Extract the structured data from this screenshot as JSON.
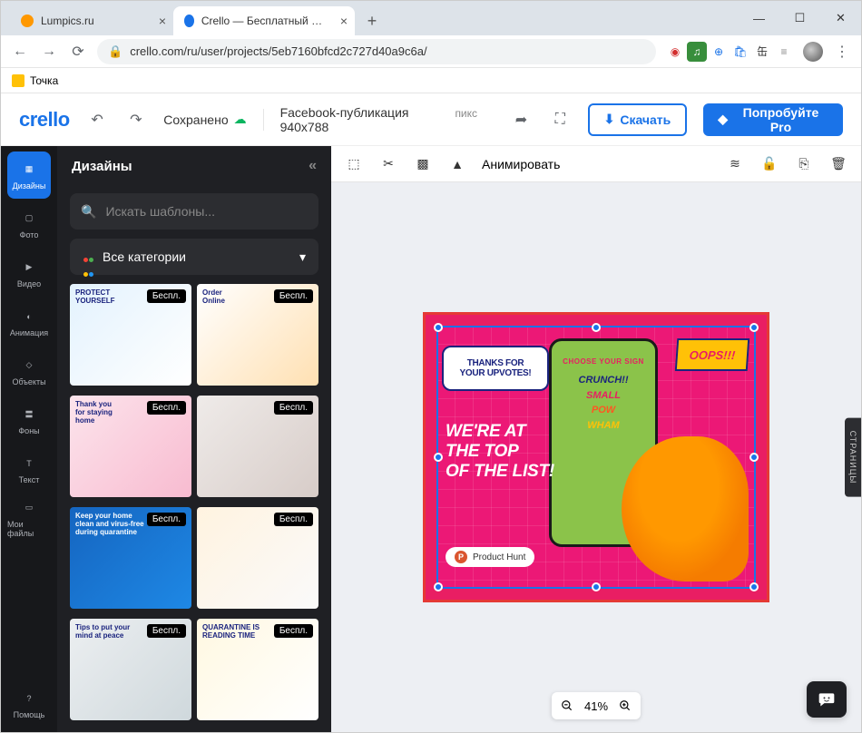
{
  "browser": {
    "tabs": [
      {
        "title": "Lumpics.ru",
        "favicon_color": "#ff9800",
        "active": false
      },
      {
        "title": "Crello — Бесплатный инструмен",
        "favicon_color": "#1a73e8",
        "active": true
      }
    ],
    "url": "crello.com/ru/user/projects/5eb7160bfcd2c727d40a9c6a/",
    "bookmarks": [
      {
        "label": "Точка"
      }
    ]
  },
  "header": {
    "logo": "crello",
    "saved_label": "Сохранено",
    "doc_name": "Facebook-публикация 940x788",
    "dim_suffix": "пикс",
    "download_label": "Скачать",
    "pro_label": "Попробуйте Pro"
  },
  "rail": {
    "items": [
      {
        "id": "designs",
        "label": "Дизайны"
      },
      {
        "id": "photo",
        "label": "Фото"
      },
      {
        "id": "video",
        "label": "Видео"
      },
      {
        "id": "animation",
        "label": "Анимация"
      },
      {
        "id": "objects",
        "label": "Объекты"
      },
      {
        "id": "backgrounds",
        "label": "Фоны"
      },
      {
        "id": "text",
        "label": "Текст"
      },
      {
        "id": "myfiles",
        "label": "Мои файлы"
      }
    ],
    "help_label": "Помощь"
  },
  "panel": {
    "title": "Дизайны",
    "search_placeholder": "Искать шаблоны...",
    "category_label": "Все категории",
    "free_badge": "Беспл.",
    "templates": [
      {
        "style": "tpl1",
        "label": "PROTECT\nYOURSELF"
      },
      {
        "style": "tpl2",
        "label": "Order\nOnline"
      },
      {
        "style": "tpl3",
        "label": "Thank you\nfor staying\nhome"
      },
      {
        "style": "tpl4",
        "label": ""
      },
      {
        "style": "tpl5",
        "label": "Keep your home\nclean and virus-free\nduring quarantine"
      },
      {
        "style": "tpl6",
        "label": ""
      },
      {
        "style": "tpl7",
        "label": "Tips to put your\nmind at peace"
      },
      {
        "style": "tpl8",
        "label": "QUARANTINE IS\nREADING TIME"
      }
    ]
  },
  "toolbar": {
    "animate_label": "Анимировать"
  },
  "canvas": {
    "bubble": "THANKS FOR\nYOUR UPVOTES!",
    "oops": "OOPS!!!",
    "headline": "WE'RE AT\nTHE TOP\nOF THE LIST!",
    "phone_title": "CHOOSE YOUR SIGN",
    "product_hunt": "Product Hunt",
    "ph_badge": "P"
  },
  "zoom": {
    "level": "41%"
  },
  "pages_tab": "СТРАНИЦЫ"
}
